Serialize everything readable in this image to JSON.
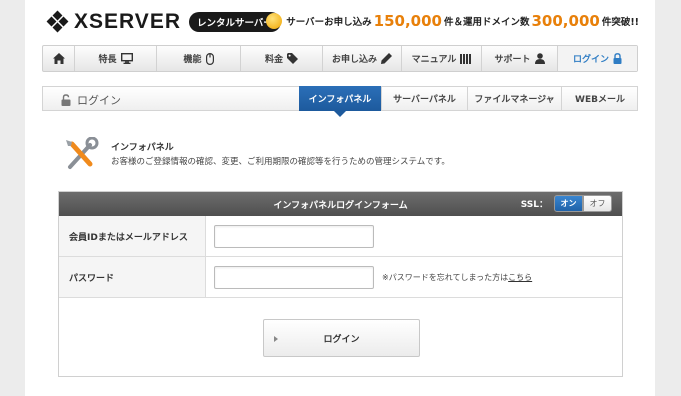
{
  "header": {
    "logo_text": "XSERVER",
    "logo_badge": "レンタルサーバー",
    "promo": {
      "prefix": "サーバーお申し込み",
      "num1": "150,000",
      "mid": "件＆運用ドメイン数",
      "num2": "300,000",
      "suffix": "件突破!!"
    }
  },
  "gnav": {
    "items": [
      {
        "label": "",
        "icon": "home-icon"
      },
      {
        "label": "特長",
        "icon": "monitor-icon"
      },
      {
        "label": "機能",
        "icon": "mouse-icon"
      },
      {
        "label": "料金",
        "icon": "tag-icon"
      },
      {
        "label": "お申し込み",
        "icon": "pencil-icon"
      },
      {
        "label": "マニュアル",
        "icon": "book-icon"
      },
      {
        "label": "サポート",
        "icon": "person-icon"
      },
      {
        "label": "ログイン",
        "icon": "lock-icon"
      }
    ]
  },
  "subnav": {
    "title": "ログイン",
    "tabs": [
      "インフォパネル",
      "サーバーパネル",
      "ファイルマネージャ",
      "WEBメール"
    ]
  },
  "info": {
    "title": "インフォパネル",
    "description": "お客様のご登録情報の確認、変更、ご利用期限の確認等を行うための管理システムです。"
  },
  "form": {
    "title": "インフォパネルログインフォーム",
    "ssl_label": "SSL：",
    "ssl_on": "オン",
    "ssl_off": "オフ",
    "id_label": "会員IDまたはメールアドレス",
    "id_value": "",
    "password_label": "パスワード",
    "password_value": "",
    "forgot_text": "※パスワードを忘れてしまった方は",
    "forgot_link": "こちら",
    "submit": "ログイン"
  },
  "colors": {
    "accent_blue": "#2f7dc4",
    "promo_orange": "#e8800a",
    "form_header": "#5a5a5a"
  }
}
